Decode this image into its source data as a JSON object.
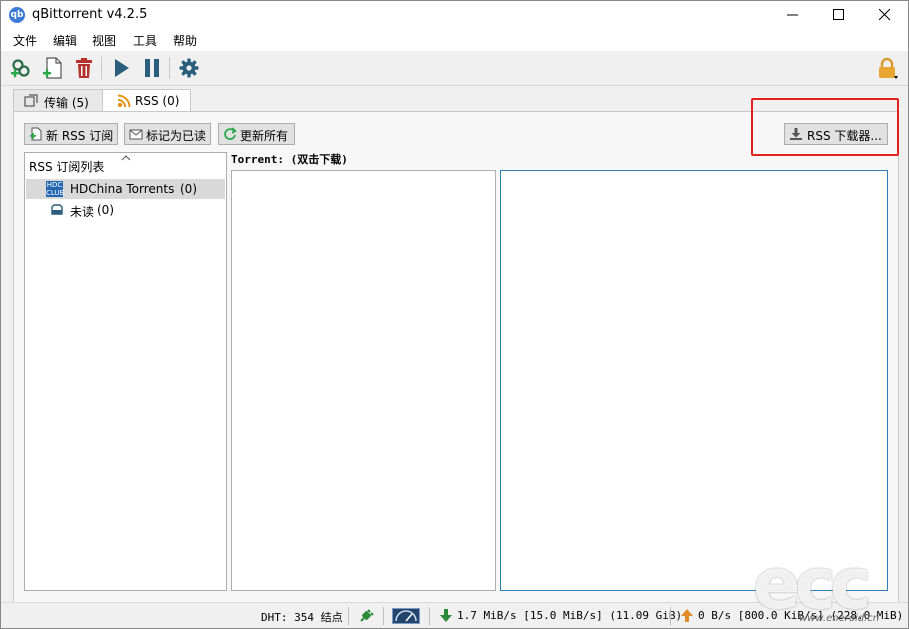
{
  "window": {
    "title": "qBittorrent v4.2.5",
    "app_icon_text": "qb"
  },
  "menu": [
    "文件",
    "编辑",
    "视图",
    "工具",
    "帮助"
  ],
  "toolbar": {
    "icons": [
      "add-torrent-link-icon",
      "add-torrent-file-icon",
      "delete-icon",
      "resume-icon",
      "pause-icon",
      "options-gear-icon"
    ],
    "lock_icon": "lock-icon"
  },
  "tabs": [
    {
      "label": "传输 (5)",
      "icon": "transfer-icon",
      "active": false
    },
    {
      "label": "RSS (0)",
      "icon": "rss-icon",
      "active": true
    }
  ],
  "rss": {
    "new_subscription": "新 RSS 订阅",
    "mark_read": "标记为已读",
    "update_all": "更新所有",
    "downloader": "RSS 下载器...",
    "feed_list_header": "RSS 订阅列表",
    "feeds": [
      {
        "name": "HDChina Torrents",
        "count": "(0)",
        "icon_text": "HDC",
        "selected": true
      },
      {
        "name": "未读",
        "count": "(0)",
        "icon_text": "",
        "selected": false
      }
    ],
    "torrent_header": "Torrent: (双击下载)"
  },
  "status": {
    "dht": "DHT: 354 结点",
    "download": "1.7 MiB/s [15.0 MiB/s] (11.09 GiB)",
    "upload": "0 B/s [800.0 KiB/s] (228.0 MiB)"
  },
  "watermark": {
    "logo": "ecc",
    "url": "www.eneroid.cn"
  },
  "colors": {
    "highlight_box": "#e0231f",
    "selection": "#d9d9d9",
    "accent_border": "#2e7db5"
  }
}
